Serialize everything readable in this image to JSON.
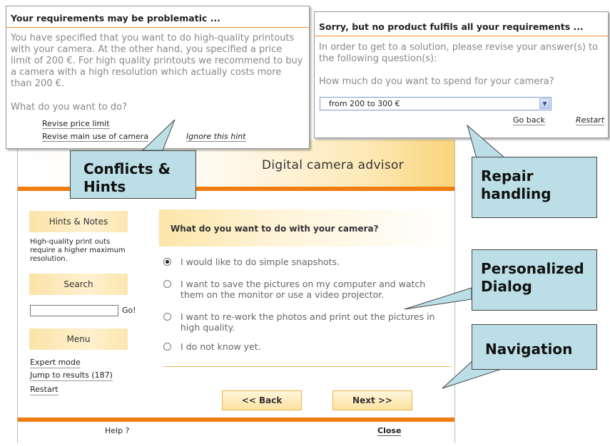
{
  "advisor": {
    "title": "Digital camera advisor",
    "hints_heading": "Hints & Notes",
    "hint_text": "High-quality print outs require a higher maximum resolution.",
    "search_heading": "Search",
    "search_value": "",
    "go_label": "Go!",
    "menu_heading": "Menu",
    "menu_items": [
      "Expert mode",
      "Jump to results (187)",
      "Restart"
    ],
    "question": "What do you want to do with your camera?",
    "options": [
      {
        "label": "I would like to do simple snapshots.",
        "selected": true
      },
      {
        "label": "I want to save the pictures on my computer and watch them on the monitor or use a video projector.",
        "selected": false
      },
      {
        "label": "I want to re-work the photos and print out the pictures in high quality.",
        "selected": false
      },
      {
        "label": "I do not know yet.",
        "selected": false
      }
    ],
    "back_label": "<< Back",
    "next_label": "Next >>",
    "help_label": "Help ?",
    "close_label": "Close"
  },
  "conflict_popup": {
    "title": "Your requirements may be problematic ...",
    "body": "You have specified that you want to do high-quality printouts with your camera. At the other hand, you specified a price limit of 200 €. For high quality printouts we recommend to buy a camera with a high resolution which actually costs more than 200 €.",
    "question": "What do you want to do?",
    "links": [
      "Revise price limit",
      "Revise main use of camera"
    ],
    "ignore_label": "Ignore this hint"
  },
  "repair_popup": {
    "title": "Sorry, but no product fulfils all your requirements ...",
    "body": "In order to get to a solution, please revise your answer(s) to the following question(s):",
    "question": "How much do you want to spend for your camera?",
    "selected_option": "from 200 to 300 €",
    "go_back_label": "Go back",
    "restart_label": "Restart"
  },
  "callouts": {
    "conflicts": "Conflicts & Hints",
    "repair": "Repair handling",
    "personalized": "Personalized Dialog",
    "navigation": "Navigation"
  },
  "colors": {
    "orange_accent": "#f07d12",
    "header_gold": "#f9d47a",
    "callout_fill": "#bcdfe7",
    "select_border": "#7a9cd3"
  }
}
